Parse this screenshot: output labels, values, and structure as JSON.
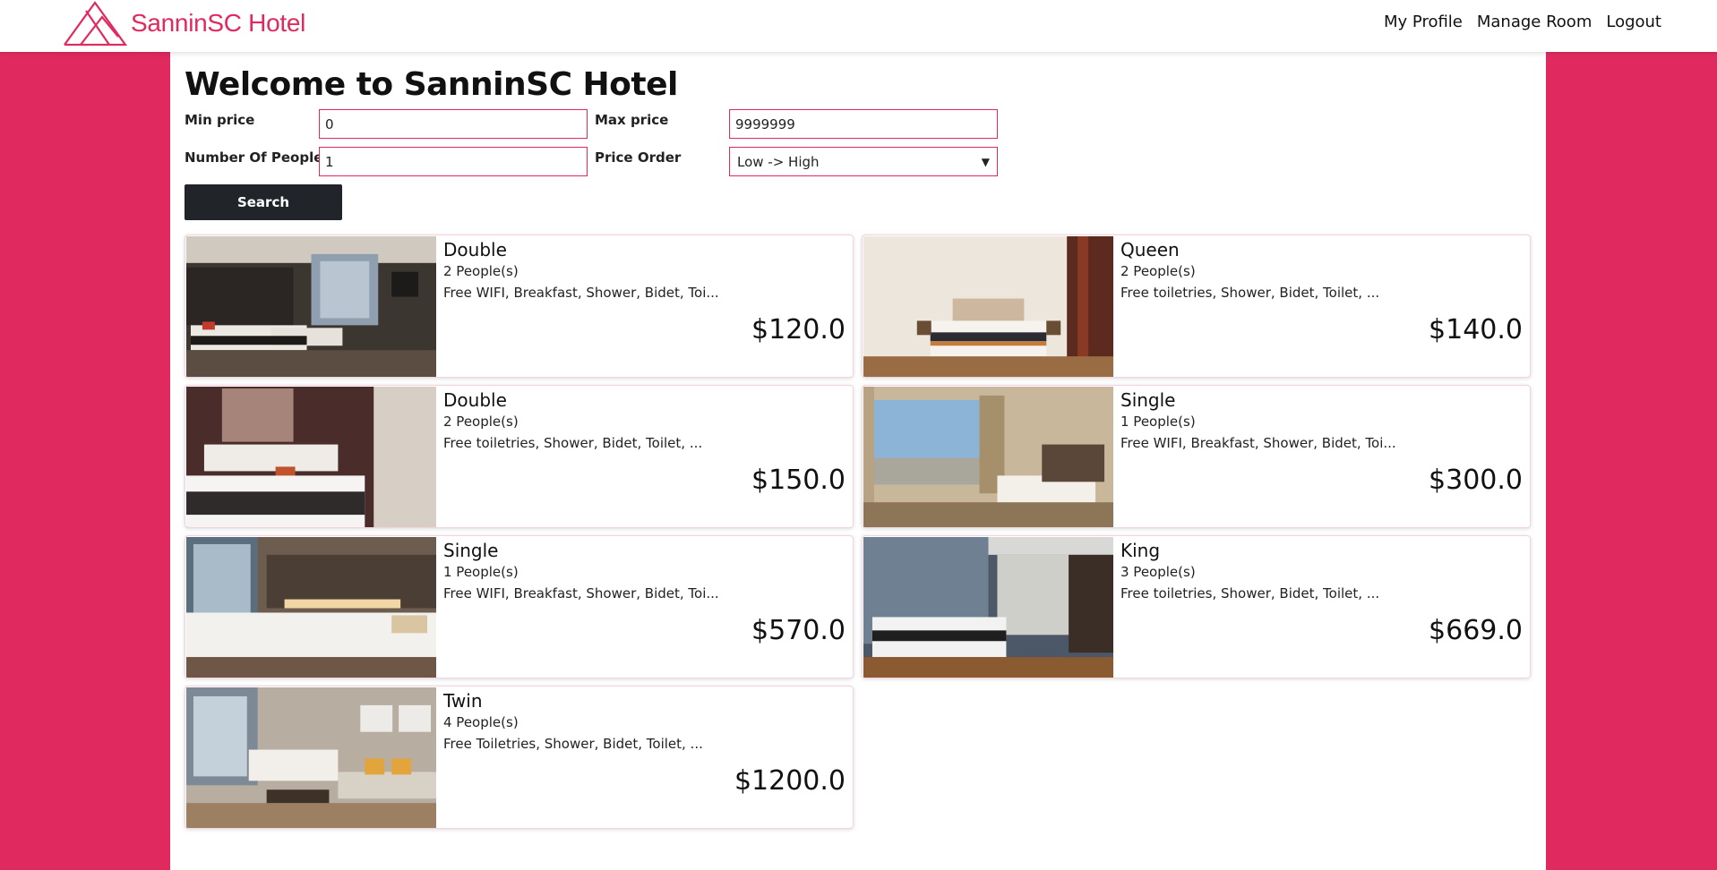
{
  "navbar": {
    "brand": "SanninSC Hotel",
    "links": [
      "My Profile",
      "Manage Room",
      "Logout"
    ],
    "brand_color": "#e02a5f"
  },
  "page": {
    "title": "Welcome to SanninSC Hotel"
  },
  "filters": {
    "min_price_label": "Min price",
    "min_price_value": "0",
    "max_price_label": "Max price",
    "max_price_value": "9999999",
    "people_label": "Number Of People",
    "people_value": "1",
    "order_label": "Price Order",
    "order_value": "Low -> High",
    "search_label": "Search"
  },
  "rooms": [
    {
      "type": "Double",
      "people": "2 People(s)",
      "amenities": "Free WIFI, Breakfast, Shower, Bidet, Toi...",
      "price": "$120.0"
    },
    {
      "type": "Queen",
      "people": "2 People(s)",
      "amenities": "Free toiletries, Shower, Bidet, Toilet, ...",
      "price": "$140.0"
    },
    {
      "type": "Double",
      "people": "2 People(s)",
      "amenities": "Free toiletries, Shower, Bidet, Toilet, ...",
      "price": "$150.0"
    },
    {
      "type": "Single",
      "people": "1 People(s)",
      "amenities": "Free WIFI, Breakfast, Shower, Bidet, Toi...",
      "price": "$300.0"
    },
    {
      "type": "Single",
      "people": "1 People(s)",
      "amenities": "Free WIFI, Breakfast, Shower, Bidet, Toi...",
      "price": "$570.0"
    },
    {
      "type": "King",
      "people": "3 People(s)",
      "amenities": "Free toiletries, Shower, Bidet, Toilet, ...",
      "price": "$669.0"
    },
    {
      "type": "Twin",
      "people": "4 People(s)",
      "amenities": "Free Toiletries, Shower, Bidet, Toilet, ...",
      "price": "$1200.0"
    }
  ],
  "colors": {
    "accent": "#e02a5f",
    "button": "#212529"
  }
}
